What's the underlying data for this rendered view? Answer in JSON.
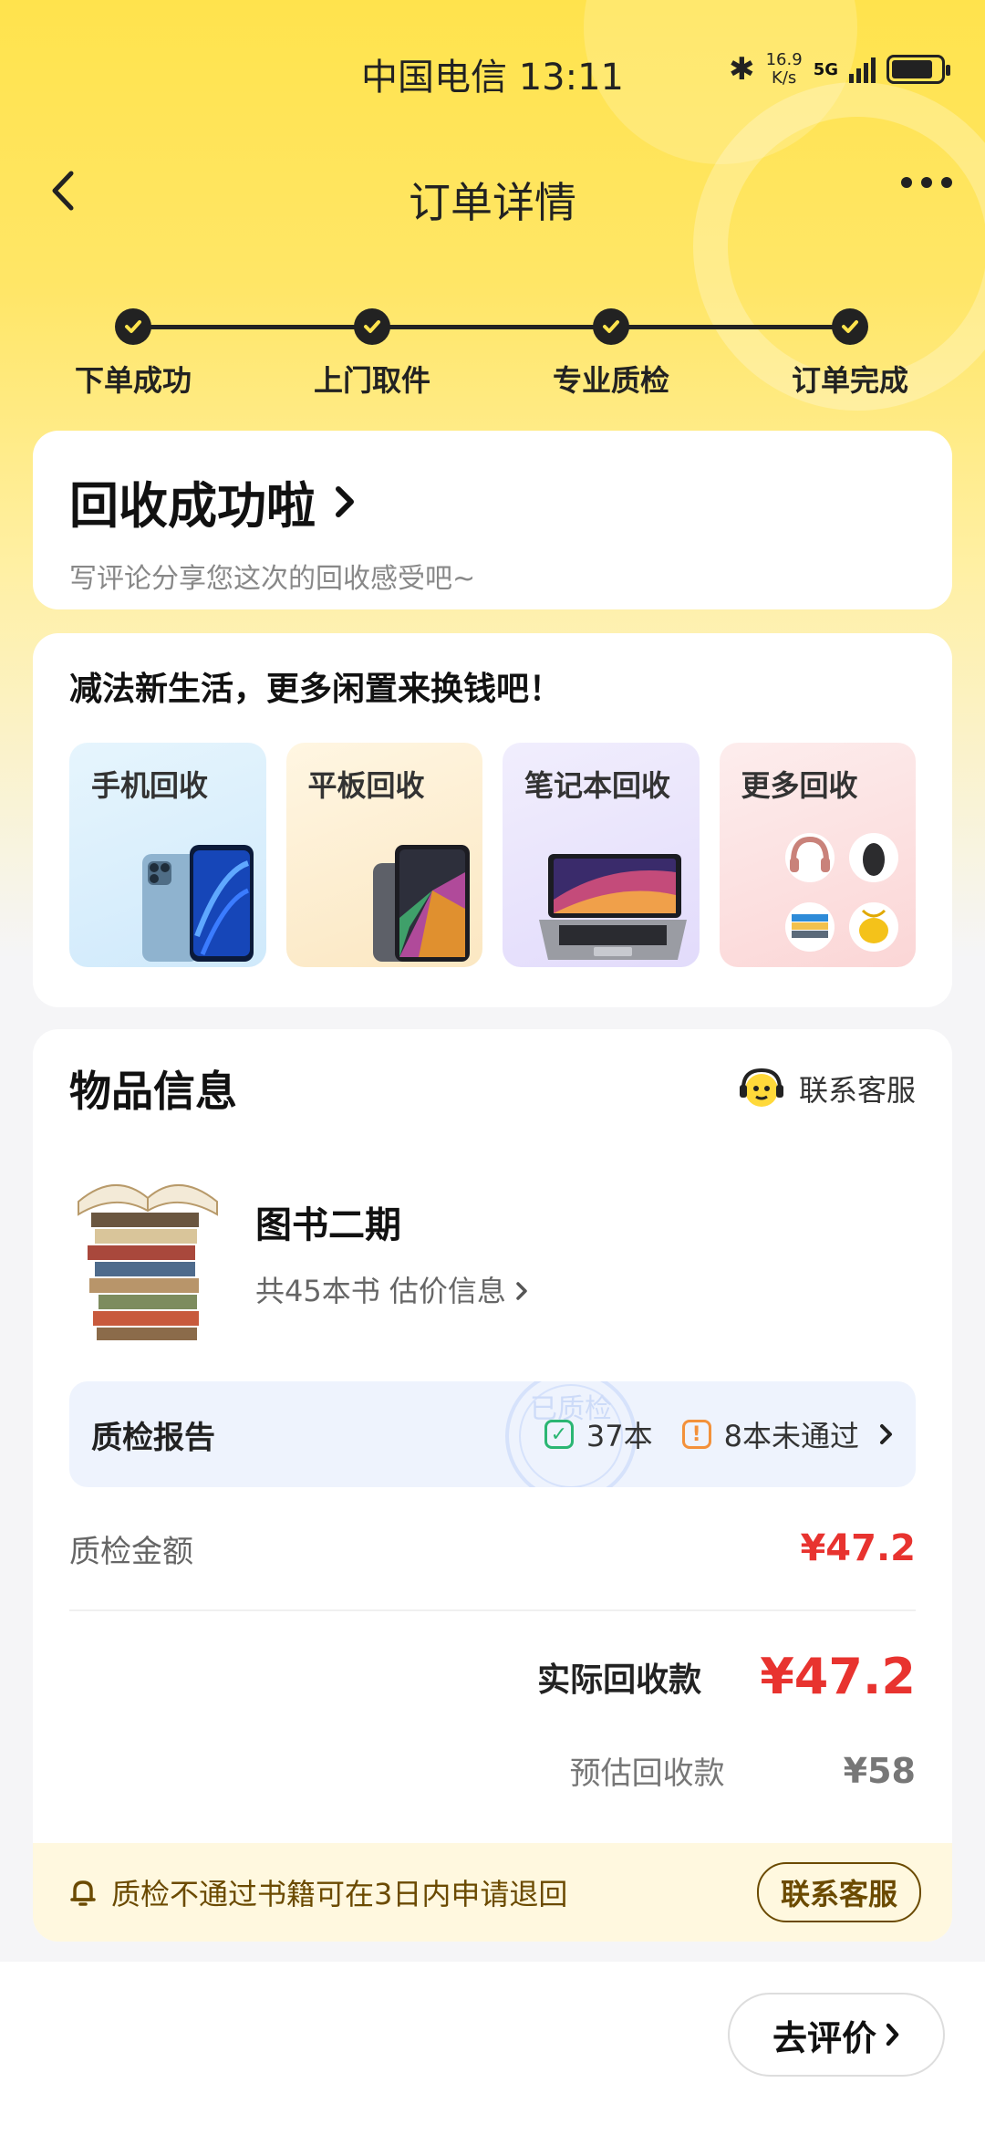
{
  "status_bar": {
    "carrier_time": "中国电信 13:11",
    "net_speed_value": "16.9",
    "net_speed_unit": "K/s",
    "network": "5G",
    "battery_level": 0.85
  },
  "nav": {
    "title": "订单详情"
  },
  "progress": {
    "steps": [
      {
        "label": "下单成功",
        "done": true
      },
      {
        "label": "上门取件",
        "done": true
      },
      {
        "label": "专业质检",
        "done": true
      },
      {
        "label": "订单完成",
        "done": true
      }
    ]
  },
  "success_card": {
    "title": "回收成功啦",
    "subtitle": "写评论分享您这次的回收感受吧~"
  },
  "promo": {
    "title": "减法新生活，更多闲置来换钱吧！",
    "tiles": [
      {
        "label": "手机回收",
        "bg": "#dff1fb"
      },
      {
        "label": "平板回收",
        "bg": "#fdf1d8"
      },
      {
        "label": "笔记本回收",
        "bg": "#ebe6fb"
      },
      {
        "label": "更多回收",
        "bg": "#fde4e4"
      }
    ]
  },
  "goods": {
    "title": "物品信息",
    "service": "联系客服",
    "item_name": "图书二期",
    "item_info": "共45本书 估价信息",
    "report": {
      "title": "质检报告",
      "passed": "37本",
      "failed": "8本未通过"
    },
    "inspect_label": "质检金额",
    "inspect_value": "¥47.2",
    "actual_label": "实际回收款",
    "actual_value": "¥47.2",
    "estimate_label": "预估回收款",
    "estimate_value": "¥58",
    "notice": "质检不通过书籍可在3日内申请退回",
    "notice_button": "联系客服"
  },
  "bottom": {
    "review_button": "去评价"
  }
}
